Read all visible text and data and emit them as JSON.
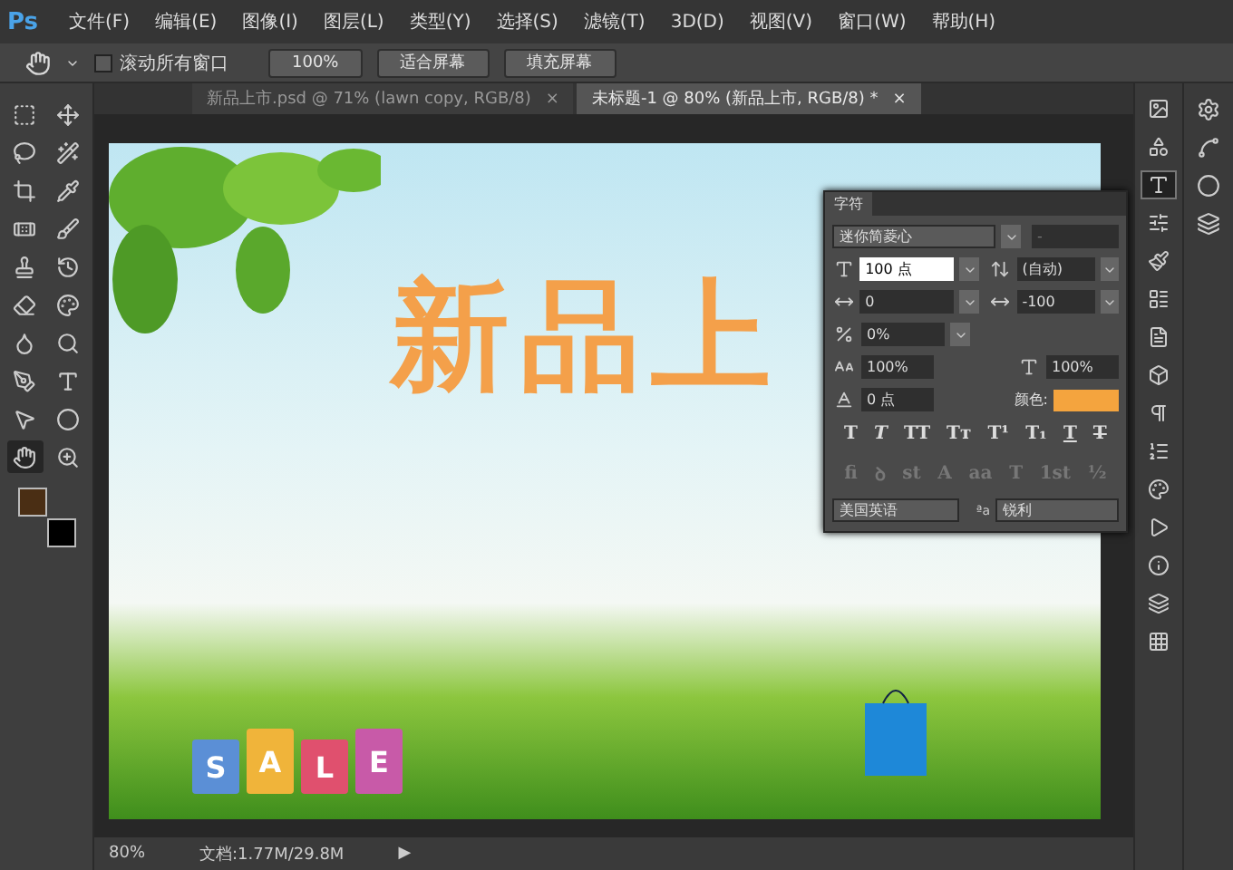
{
  "app_logo": "Ps",
  "menu": [
    "文件(F)",
    "编辑(E)",
    "图像(I)",
    "图层(L)",
    "类型(Y)",
    "选择(S)",
    "滤镜(T)",
    "3D(D)",
    "视图(V)",
    "窗口(W)",
    "帮助(H)"
  ],
  "options_bar": {
    "scroll_all": {
      "label": "滚动所有窗口",
      "checked": false
    },
    "buttons": [
      "100%",
      "适合屏幕",
      "填充屏幕"
    ]
  },
  "doc_tabs": [
    {
      "title": "新品上市.psd @ 71% (lawn copy, RGB/8)",
      "close": "×",
      "selected": false
    },
    {
      "title": "未标题-1 @ 80% (新品上市, RGB/8) *",
      "close": "×",
      "selected": true
    }
  ],
  "tools": [
    {
      "selected": false
    },
    {
      "selected": false
    },
    {
      "selected": false
    },
    {
      "selected": false
    },
    {
      "selected": false
    },
    {
      "selected": false
    },
    {
      "selected": false
    },
    {
      "selected": false
    },
    {
      "selected": false
    },
    {
      "selected": false
    },
    {
      "selected": false
    },
    {
      "selected": false
    },
    {
      "selected": false
    },
    {
      "selected": false
    },
    {
      "selected": false
    },
    {
      "selected": false
    },
    {
      "selected": false
    },
    {
      "selected": false
    },
    {
      "selected": true
    },
    {
      "selected": false
    }
  ],
  "canvas": {
    "headline": "新品上",
    "bags": [
      {
        "letter": "S",
        "color": "#5b8fd6"
      },
      {
        "letter": "A",
        "color": "#f0b43a"
      },
      {
        "letter": "L",
        "color": "#e0506e"
      },
      {
        "letter": "E",
        "color": "#c85aa8"
      }
    ]
  },
  "character_panel": {
    "tab": "字符",
    "font_family": "迷你简菱心",
    "font_style": "-",
    "size": "100 点",
    "leading": "(自动)",
    "kerning": "0",
    "tracking": "-100",
    "proportional": "0%",
    "vertical_scale": "100%",
    "horizontal_scale": "100%",
    "baseline": "0 点",
    "color_label": "颜色:",
    "color": "#f4a43e",
    "style_buttons": [
      {
        "label": "T",
        "kind": "bold"
      },
      {
        "label": "T",
        "kind": "italic"
      },
      {
        "label": "TT",
        "kind": "caps"
      },
      {
        "label": "Tт",
        "kind": "smallcaps"
      },
      {
        "label": "T¹",
        "kind": "super"
      },
      {
        "label": "T₁",
        "kind": "sub"
      },
      {
        "label": "T",
        "kind": "underline"
      },
      {
        "label": "T",
        "kind": "strike"
      }
    ],
    "opentype_buttons": [
      {
        "label": "fi",
        "disabled": true
      },
      {
        "label": "ꝺ",
        "disabled": true
      },
      {
        "label": "st",
        "disabled": true
      },
      {
        "label": "A",
        "disabled": true
      },
      {
        "label": "aa",
        "disabled": true
      },
      {
        "label": "T",
        "disabled": true
      },
      {
        "label": "1st",
        "disabled": true
      },
      {
        "label": "½",
        "disabled": true
      }
    ],
    "language": "美国英语",
    "aa_label": "ªa",
    "antialias": "锐利"
  },
  "right_panel_icons": [
    {
      "selected": false
    },
    {
      "selected": false
    },
    {
      "selected": true
    },
    {
      "selected": false
    },
    {
      "selected": false
    },
    {
      "selected": false
    },
    {
      "selected": false
    },
    {
      "selected": false
    },
    {
      "selected": false
    },
    {
      "selected": false
    },
    {
      "selected": false
    },
    {
      "selected": false
    },
    {
      "selected": false
    },
    {
      "selected": false
    },
    {
      "selected": false
    }
  ],
  "status_bar": {
    "zoom": "80%",
    "doc_info": "文档:1.77M/29.8M",
    "arrow": "▶"
  }
}
